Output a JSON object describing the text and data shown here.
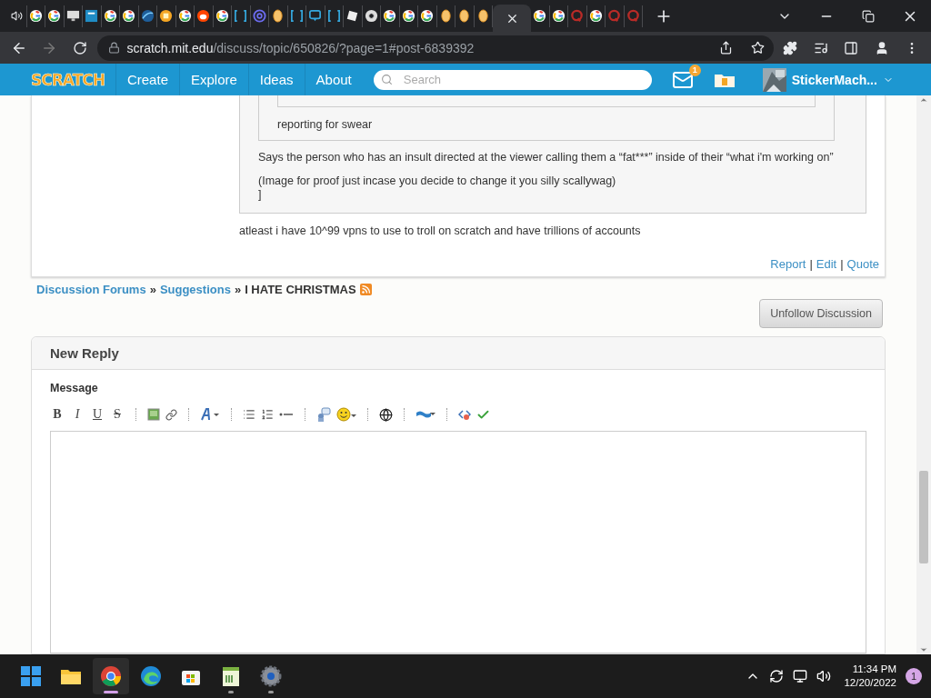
{
  "browser": {
    "tabs": [
      {
        "kind": "audio",
        "selected": false
      },
      {
        "kind": "google",
        "selected": false
      },
      {
        "kind": "google",
        "selected": false
      },
      {
        "kind": "monitor",
        "selected": false
      },
      {
        "kind": "tl",
        "selected": false
      },
      {
        "kind": "google",
        "selected": false
      },
      {
        "kind": "google",
        "selected": false
      },
      {
        "kind": "wave",
        "selected": false
      },
      {
        "kind": "grid",
        "selected": false
      },
      {
        "kind": "google",
        "selected": false
      },
      {
        "kind": "reddit",
        "selected": false
      },
      {
        "kind": "google",
        "selected": false
      },
      {
        "kind": "brackets",
        "selected": false
      },
      {
        "kind": "at",
        "selected": false
      },
      {
        "kind": "coin",
        "selected": false
      },
      {
        "kind": "brackets",
        "selected": false
      },
      {
        "kind": "chat",
        "selected": false
      },
      {
        "kind": "brackets",
        "selected": false
      },
      {
        "kind": "roblox",
        "selected": false
      },
      {
        "kind": "chrome",
        "selected": false
      },
      {
        "kind": "google",
        "selected": false
      },
      {
        "kind": "google",
        "selected": false
      },
      {
        "kind": "google",
        "selected": false
      },
      {
        "kind": "coin",
        "selected": false
      },
      {
        "kind": "coin",
        "selected": false
      },
      {
        "kind": "coin",
        "selected": false
      },
      {
        "selected": true
      },
      {
        "kind": "google",
        "selected": false
      },
      {
        "kind": "google",
        "selected": false
      },
      {
        "kind": "quora",
        "selected": false
      },
      {
        "kind": "google",
        "selected": false
      },
      {
        "kind": "quora",
        "selected": false
      },
      {
        "kind": "quora",
        "selected": false
      }
    ],
    "address": {
      "host": "scratch.mit.edu",
      "path": "/discuss/topic/650826/?page=1#post-6839392"
    }
  },
  "nav": {
    "logo": "SCRATCH",
    "items": [
      "Create",
      "Explore",
      "Ideas",
      "About"
    ],
    "search": {
      "placeholder": "Search"
    },
    "messages_badge": "1",
    "username": "StickerMach..."
  },
  "post": {
    "outer_quote": {
      "inner_quote": {
        "text": "reporting for swear"
      },
      "paragraphs": [
        [
          "Says the person who has an insult directed at the viewer calling them a “fat***” inside of their “what i'm working on”"
        ],
        [
          "(Image for proof just incase you decide to change it you silly scallywag)",
          "]"
        ]
      ]
    },
    "text": "atleast i have 10^99 vpns to use to troll on scratch and have trillions of accounts",
    "actions": [
      "Report",
      "Edit",
      "Quote"
    ],
    "separator": "|"
  },
  "breadcrumb": {
    "links": [
      "Discussion Forums",
      "Suggestions"
    ],
    "current": "I HATE CHRISTMAS",
    "separator": "»"
  },
  "unfollow_button": "Unfollow Discussion",
  "reply": {
    "title": "New Reply",
    "label": "Message",
    "format_buttons": [
      {
        "kind": "bold",
        "label": "B"
      },
      {
        "kind": "italic",
        "label": "I"
      },
      {
        "kind": "underline",
        "label": "U"
      },
      {
        "kind": "strike",
        "label": "S"
      }
    ]
  },
  "taskbar": {
    "apps": [
      {
        "kind": "start",
        "selected": false,
        "running": false
      },
      {
        "kind": "folder",
        "selected": false,
        "running": false
      },
      {
        "kind": "chrome",
        "selected": true,
        "running": true
      },
      {
        "kind": "edge",
        "selected": false,
        "running": false
      },
      {
        "kind": "store",
        "selected": false,
        "running": false
      },
      {
        "kind": "notepad",
        "selected": false,
        "running": true
      },
      {
        "kind": "settings",
        "selected": false,
        "running": true
      }
    ],
    "time": "11:34 PM",
    "date": "12/20/2022",
    "notifications": "1"
  }
}
